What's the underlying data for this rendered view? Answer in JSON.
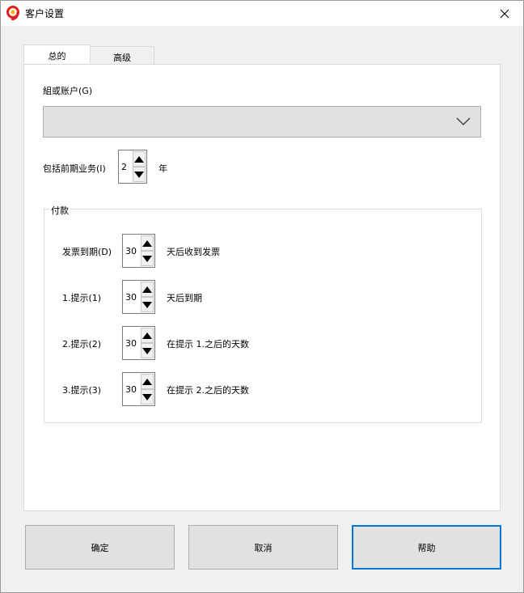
{
  "window": {
    "title": "客户设置",
    "close_glyph": "✕"
  },
  "tabs": [
    {
      "label": "总的",
      "active": true
    },
    {
      "label": "高级",
      "active": false
    }
  ],
  "general": {
    "group_account_label": "組或账户(G)",
    "group_account_value": "",
    "include_prior_label": "包括前期业务(I)",
    "include_prior_value": "2",
    "include_prior_unit": "年"
  },
  "payment": {
    "legend": "付款",
    "rows": [
      {
        "label": "发票到期(D)",
        "value": "30",
        "suffix": "天后收到发票"
      },
      {
        "label": "1.提示(1)",
        "value": "30",
        "suffix": "天后到期"
      },
      {
        "label": "2.提示(2)",
        "value": "30",
        "suffix": "在提示 1.之后的天数"
      },
      {
        "label": "3.提示(3)",
        "value": "30",
        "suffix": "在提示 2.之后的天数"
      }
    ]
  },
  "buttons": {
    "ok": "确定",
    "cancel": "取消",
    "help": "帮助"
  },
  "colors": {
    "accent": "#0078d7",
    "app_icon_red": "#e02020",
    "app_icon_yellow": "#f5b400"
  }
}
